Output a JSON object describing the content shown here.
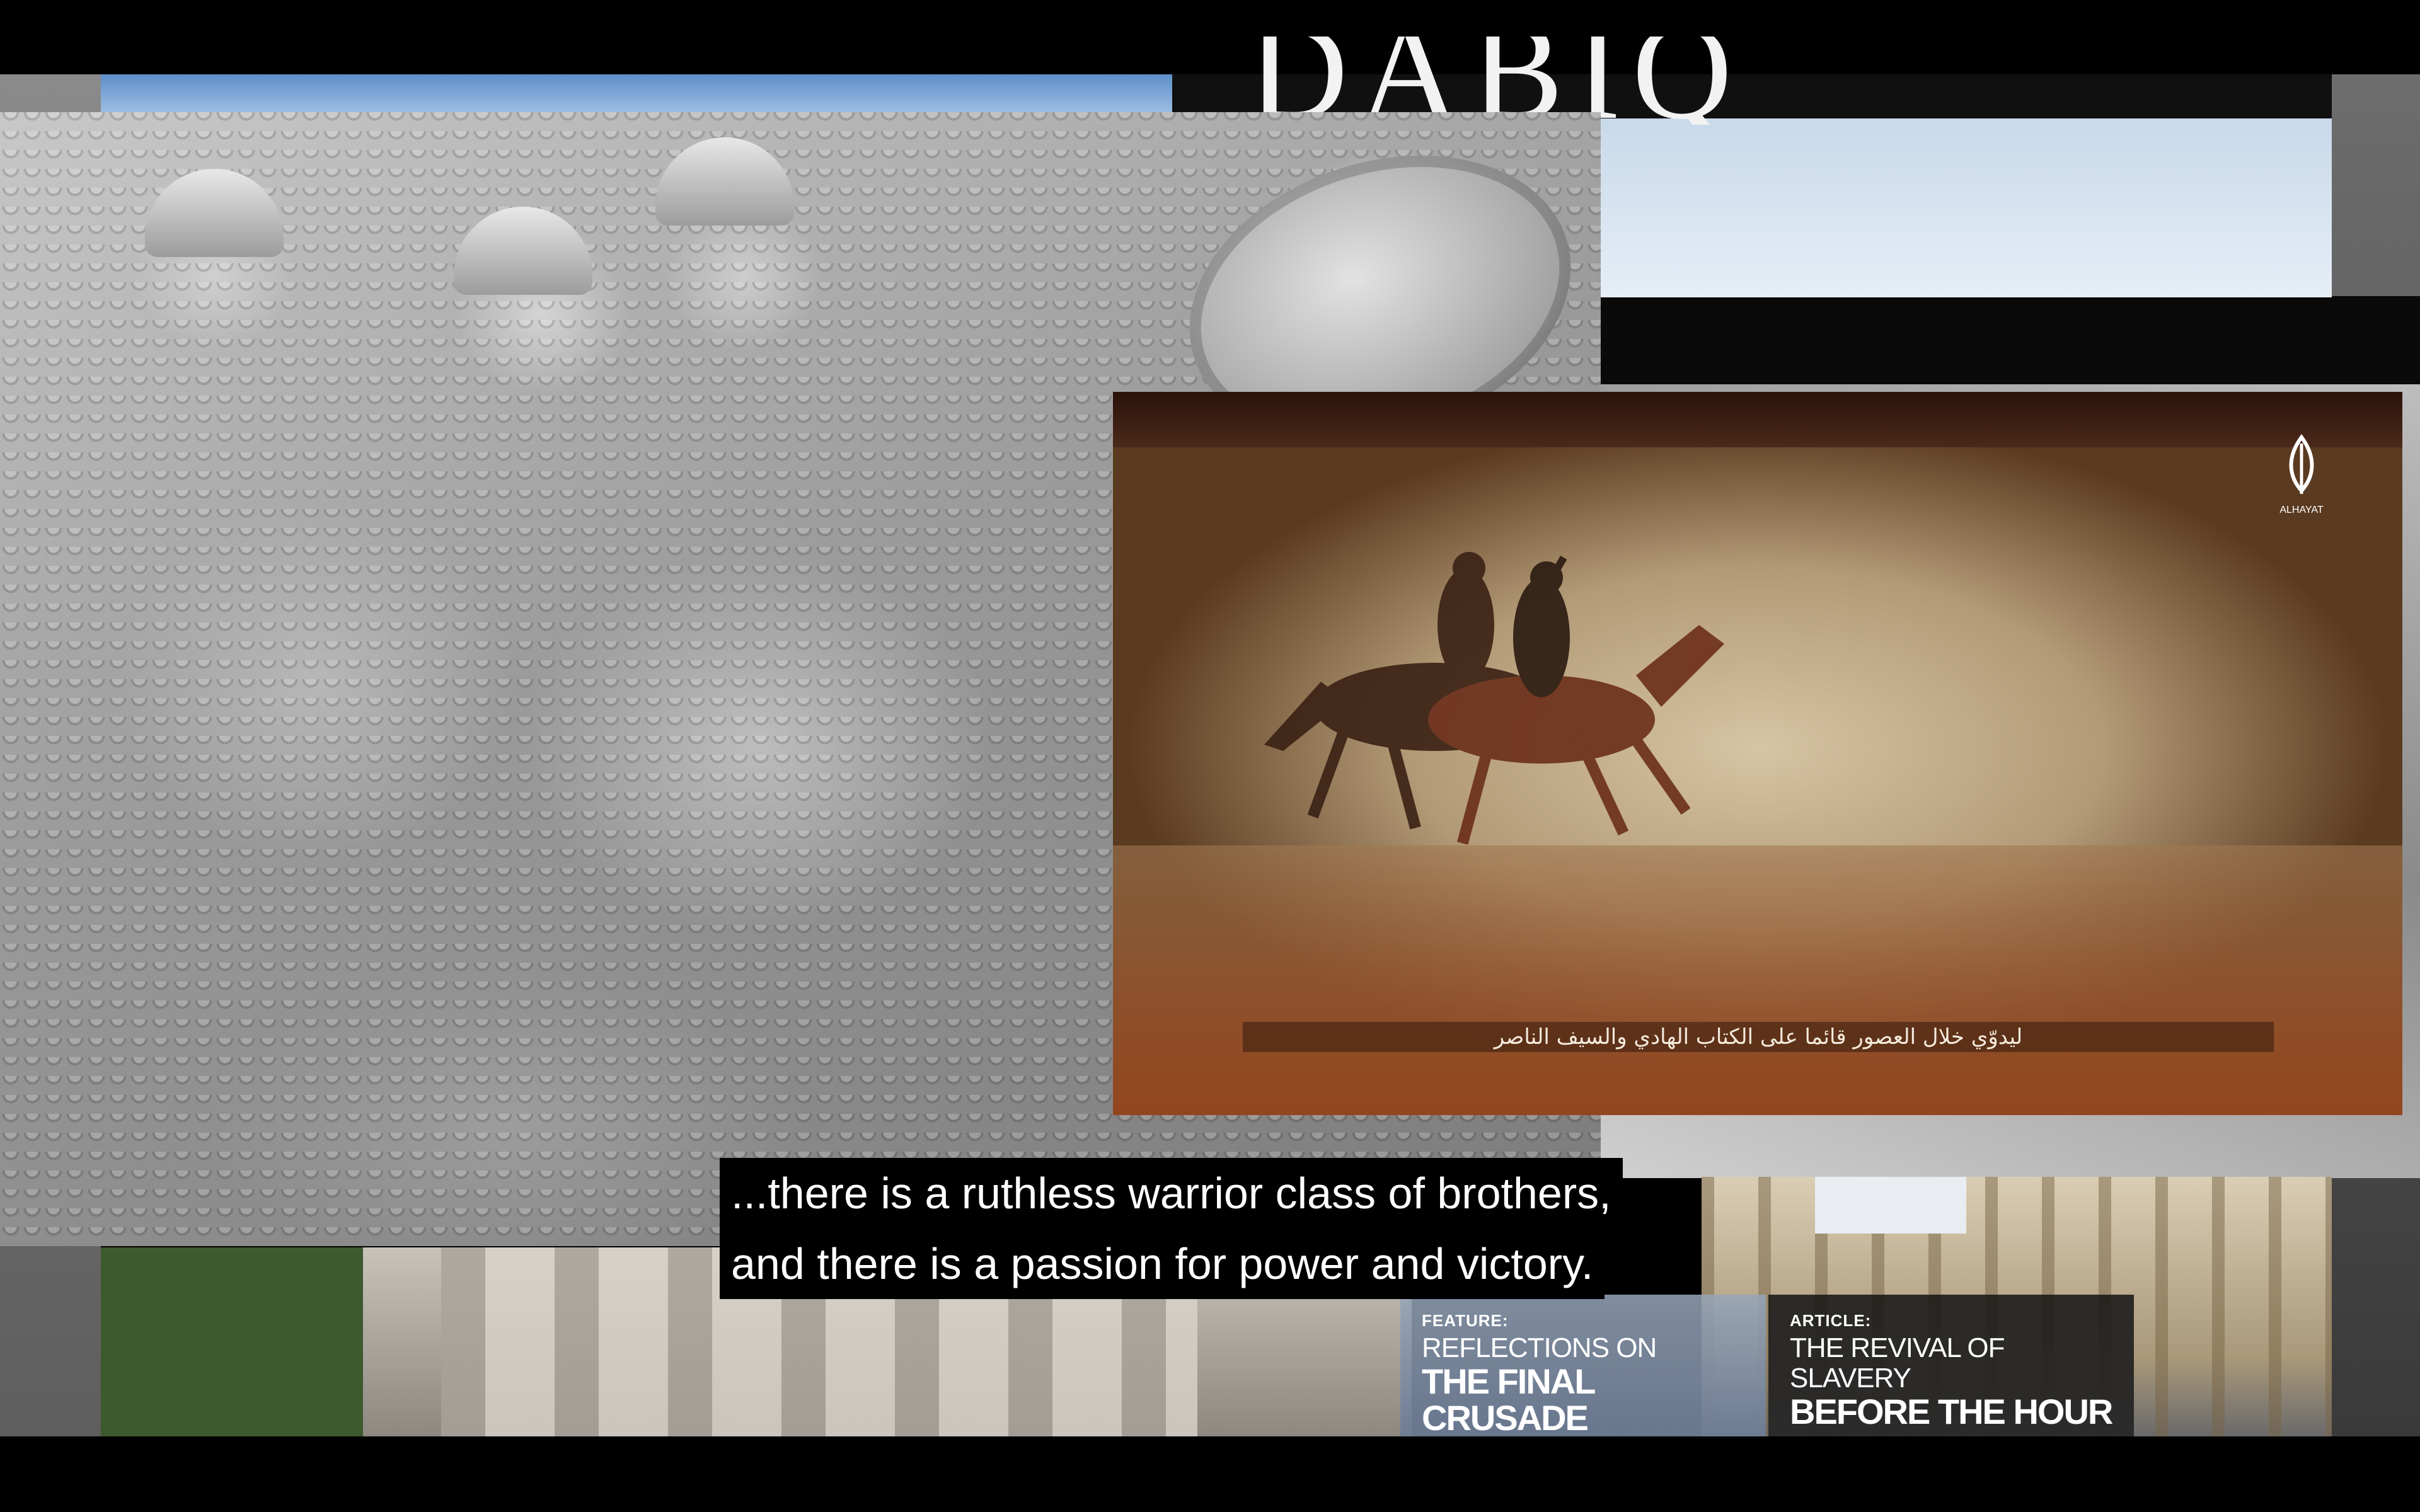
{
  "caption": {
    "line1": "...there is a ruthless warrior class of brothers,",
    "line2": "and there is a passion for power and victory."
  },
  "magazine": {
    "masthead": "DABIQ",
    "feature": {
      "kicker": "FEATURE:",
      "line1": "REFLECTIONS ON",
      "line2": "THE FINAL CRUSADE"
    },
    "article": {
      "kicker": "ARTICLE:",
      "line1": "THE REVIVAL OF SLAVERY",
      "line2": "BEFORE THE HOUR"
    }
  },
  "video": {
    "subtitle": "ليدوّي خلال العصور قائما على الكتاب الهادي والسيف الناصر",
    "watermark_label": "ALHAYAT"
  }
}
